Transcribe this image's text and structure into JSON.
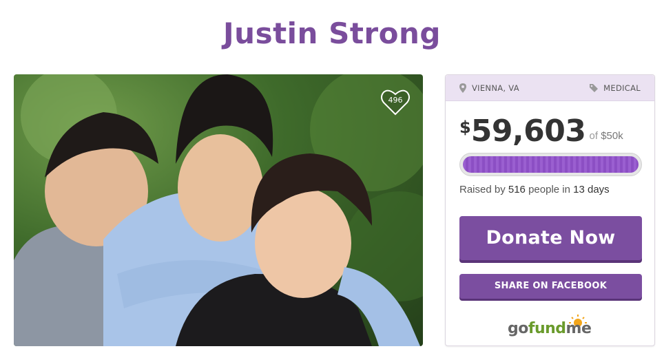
{
  "page": {
    "title": "Justin Strong"
  },
  "photo": {
    "likes": "496"
  },
  "card": {
    "location": "VIENNA, VA",
    "category": "MEDICAL",
    "currency": "$",
    "amount": "59,603",
    "goal_prefix": "of",
    "goal": "$50k",
    "progress_fraction": 1.0,
    "raised_prefix": "Raised by",
    "donors": "516",
    "raised_middle": "people in",
    "days": "13 days",
    "donate_label": "Donate Now",
    "share_label": "SHARE ON FACEBOOK"
  },
  "logo": {
    "go": "go",
    "fund": "fund",
    "me": "me"
  },
  "colors": {
    "brand": "#7b4ea0",
    "title": "#7a4d9c",
    "progress": "#9a5fd0",
    "logo_green": "#6a9b2c"
  }
}
